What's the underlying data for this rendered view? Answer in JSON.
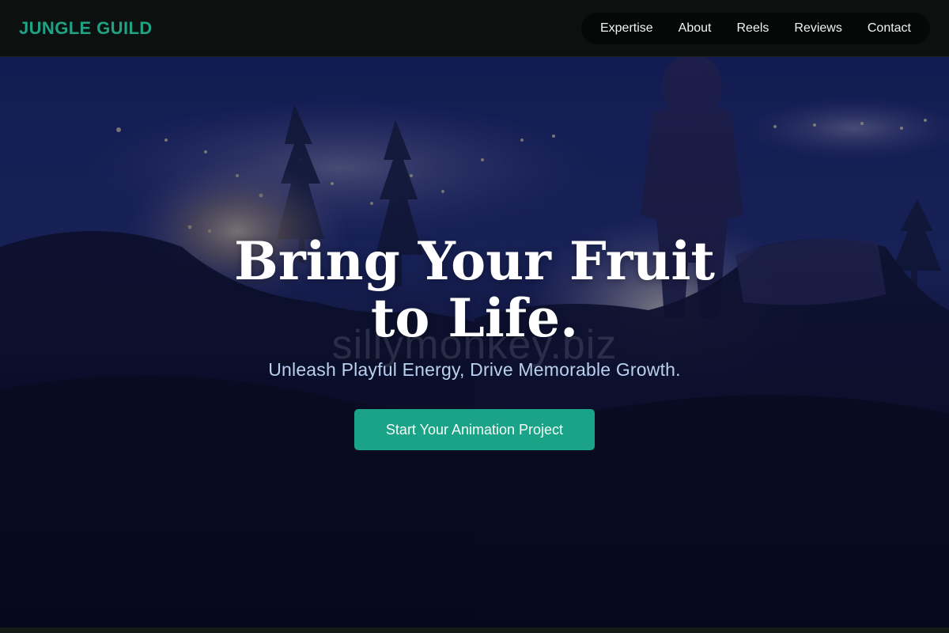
{
  "header": {
    "logo": "JUNGLE GUILD",
    "nav": [
      "Expertise",
      "About",
      "Reels",
      "Reviews",
      "Contact"
    ]
  },
  "hero": {
    "headline": "Bring Your Fruit to Life.",
    "watermark": "sillymonkey.biz",
    "subheadline": "Unleash Playful Energy, Drive Memorable Growth.",
    "cta_label": "Start Your Animation Project"
  },
  "colors": {
    "accent": "#1aa386",
    "logo": "#1fa384",
    "header_bg": "#0c1110",
    "subheadline": "#b7d1ee"
  }
}
